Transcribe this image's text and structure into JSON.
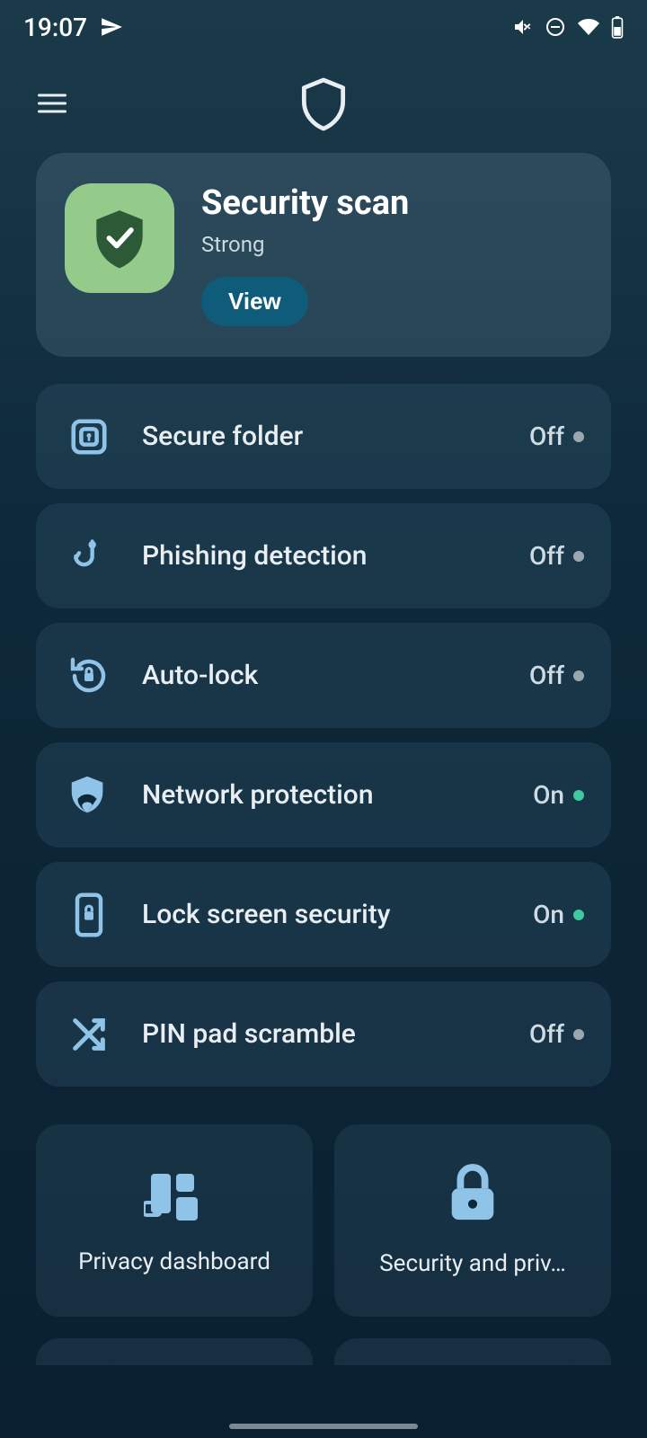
{
  "status": {
    "time": "19:07"
  },
  "scan": {
    "title": "Security scan",
    "status": "Strong",
    "button": "View"
  },
  "settings": [
    {
      "id": "secure-folder",
      "label": "Secure folder",
      "state": "Off",
      "on": false
    },
    {
      "id": "phishing-detection",
      "label": "Phishing detection",
      "state": "Off",
      "on": false
    },
    {
      "id": "auto-lock",
      "label": "Auto-lock",
      "state": "Off",
      "on": false
    },
    {
      "id": "network-protection",
      "label": "Network protection",
      "state": "On",
      "on": true
    },
    {
      "id": "lock-screen-security",
      "label": "Lock screen security",
      "state": "On",
      "on": true
    },
    {
      "id": "pin-pad-scramble",
      "label": "PIN pad scramble",
      "state": "Off",
      "on": false
    }
  ],
  "cards": [
    {
      "id": "privacy-dashboard",
      "label": "Privacy dashboard"
    },
    {
      "id": "security-and-privacy",
      "label": "Security and priv…"
    }
  ]
}
